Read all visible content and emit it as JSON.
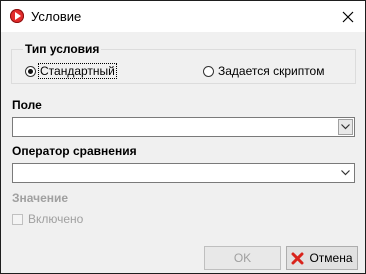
{
  "window": {
    "title": "Условие",
    "icon": "app-icon",
    "close_icon": "close-icon"
  },
  "condition_type": {
    "title": "Тип условия",
    "options": [
      {
        "label": "Стандартный",
        "selected": true
      },
      {
        "label": "Задается скриптом",
        "selected": false
      }
    ]
  },
  "field": {
    "label": "Поле",
    "value": ""
  },
  "operator": {
    "label": "Оператор сравнения",
    "value": ""
  },
  "value_section": {
    "label": "Значение",
    "checkbox_label": "Включено",
    "checked": false,
    "enabled": false
  },
  "buttons": {
    "ok_label": "OK",
    "cancel_label": "Отмена",
    "cancel_icon": "cancel-icon"
  }
}
